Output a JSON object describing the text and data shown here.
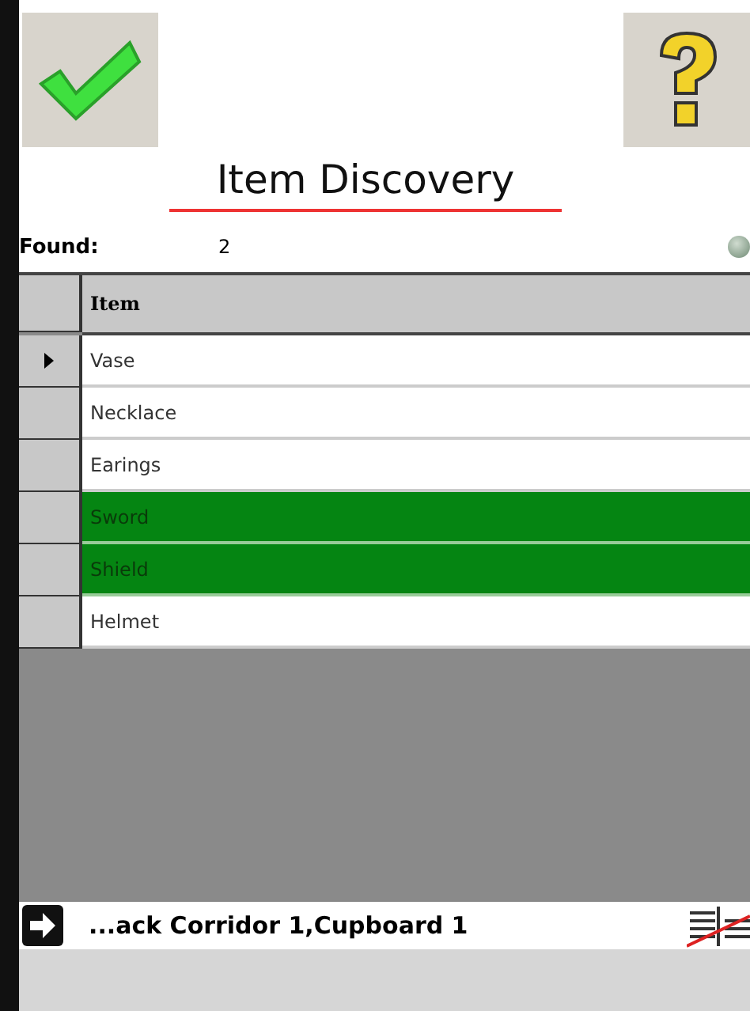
{
  "title": "Item Discovery",
  "found": {
    "label": "Found:",
    "value": "2"
  },
  "table": {
    "columns": [
      "Item"
    ],
    "rows": [
      {
        "item": "Vase",
        "current": true,
        "found": false
      },
      {
        "item": "Necklace",
        "current": false,
        "found": false
      },
      {
        "item": "Earings",
        "current": false,
        "found": false
      },
      {
        "item": "Sword",
        "current": false,
        "found": true
      },
      {
        "item": "Shield",
        "current": false,
        "found": true
      },
      {
        "item": "Helmet",
        "current": false,
        "found": false
      }
    ]
  },
  "status_bar": {
    "location": "...ack Corridor 1,Cupboard 1"
  }
}
